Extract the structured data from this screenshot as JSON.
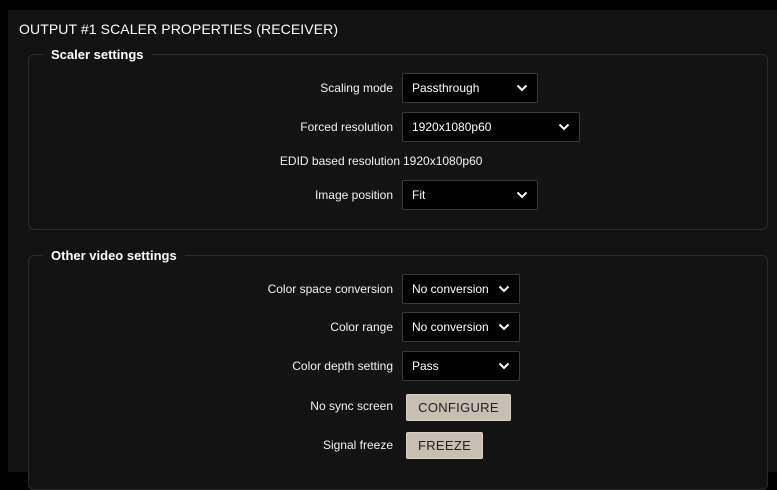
{
  "panel": {
    "title": "OUTPUT #1 SCALER PROPERTIES (RECEIVER)"
  },
  "scaler_settings": {
    "legend": "Scaler settings",
    "scaling_mode": {
      "label": "Scaling mode",
      "value": "Passthrough"
    },
    "forced_resolution": {
      "label": "Forced resolution",
      "value": "1920x1080p60"
    },
    "edid_resolution": {
      "label": "EDID based resolution",
      "value": "1920x1080p60"
    },
    "image_position": {
      "label": "Image position",
      "value": "Fit"
    }
  },
  "other_video_settings": {
    "legend": "Other video settings",
    "color_space_conversion": {
      "label": "Color space conversion",
      "value": "No conversion"
    },
    "color_range": {
      "label": "Color range",
      "value": "No conversion"
    },
    "color_depth": {
      "label": "Color depth setting",
      "value": "Pass"
    },
    "no_sync_screen": {
      "label": "No sync screen",
      "button": "CONFIGURE"
    },
    "signal_freeze": {
      "label": "Signal freeze",
      "button": "FREEZE"
    }
  },
  "icons": {
    "dropdown": "chevron-down-icon"
  }
}
